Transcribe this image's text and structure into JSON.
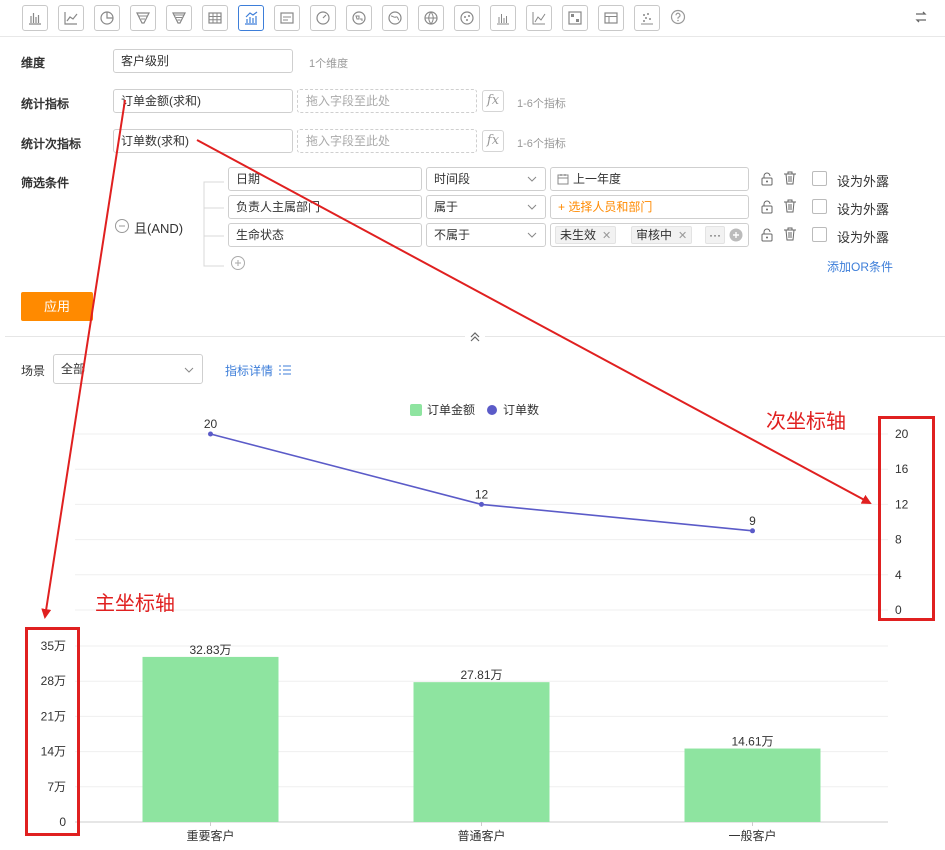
{
  "toolbar": {
    "icons": [
      "bar-chart-icon",
      "line-chart-icon",
      "pie-chart-icon",
      "funnel-icon",
      "funnel-alt-icon",
      "table-icon",
      "combo-chart-icon",
      "card-icon",
      "gauge-icon",
      "map-cn-icon",
      "map-world-icon",
      "globe-icon",
      "scatter-icon",
      "bar-small-icon",
      "line-small-icon",
      "pivot-icon",
      "detail-table-icon",
      "dots-icon",
      "help-icon"
    ],
    "active_index": 6
  },
  "form": {
    "dimension_label": "维度",
    "dimension_value": "客户级别",
    "dimension_hint": "1个维度",
    "metric_label": "统计指标",
    "metric_value": "订单金额(求和)",
    "metric_drop": "拖入字段至此处",
    "metric_hint": "1-6个指标",
    "secondary_label": "统计次指标",
    "secondary_value": "订单数(求和)",
    "secondary_drop": "拖入字段至此处",
    "secondary_hint": "1-6个指标",
    "fx": "fx",
    "filter_label": "筛选条件",
    "logic": "且(AND)",
    "filters": [
      {
        "field": "日期",
        "op": "时间段",
        "value": "上一年度",
        "expose": "设为外露"
      },
      {
        "field": "负责人主属部门",
        "op": "属于",
        "value": "+ 选择人员和部门",
        "expose": "设为外露"
      },
      {
        "field": "生命状态",
        "op": "不属于",
        "tags": [
          "未生效",
          "审核中"
        ],
        "more": "···",
        "expose": "设为外露"
      }
    ],
    "add_or": "添加OR条件",
    "apply": "应用"
  },
  "scene": {
    "label": "场景",
    "value": "全部",
    "detail_link": "指标详情"
  },
  "annotations": {
    "secondary_axis": "次坐标轴",
    "primary_axis": "主坐标轴"
  },
  "chart_data": {
    "type": "bar",
    "categories": [
      "重要客户",
      "普通客户",
      "一般客户"
    ],
    "series": [
      {
        "name": "订单金额",
        "type": "bar",
        "axis": "primary",
        "values": [
          32.83,
          27.81,
          14.61
        ],
        "labels": [
          "32.83万",
          "27.81万",
          "14.61万"
        ],
        "color": "#8ee4a0"
      },
      {
        "name": "订单数",
        "type": "line",
        "axis": "secondary",
        "values": [
          20,
          12,
          9
        ],
        "labels": [
          "20",
          "12",
          "9"
        ],
        "color": "#5b5bc8"
      }
    ],
    "primary_axis": {
      "ylim": [
        0,
        35
      ],
      "ticks": [
        0,
        7,
        14,
        21,
        28,
        35
      ],
      "tick_labels": [
        "0",
        "7万",
        "14万",
        "21万",
        "28万",
        "35万"
      ]
    },
    "secondary_axis": {
      "ylim": [
        0,
        20
      ],
      "ticks": [
        0,
        4,
        8,
        12,
        16,
        20
      ],
      "tick_labels": [
        "0",
        "4",
        "8",
        "12",
        "16",
        "20"
      ]
    },
    "legend": "top-center",
    "grid": true
  }
}
